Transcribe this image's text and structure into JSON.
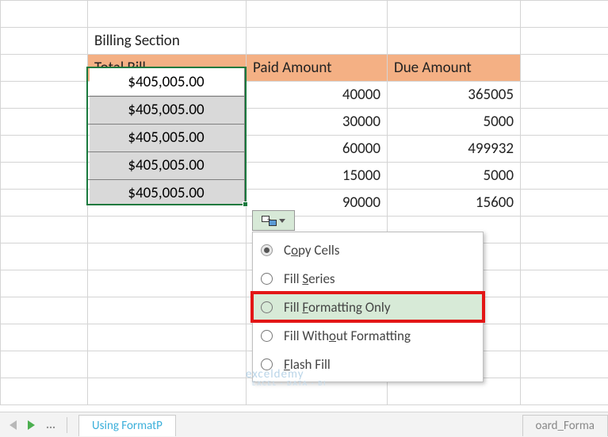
{
  "title_row": {
    "label": "Billing Section"
  },
  "headers": {
    "total": "Total Bill",
    "paid": "Paid Amount",
    "due": "Due Amount"
  },
  "rows": [
    {
      "total": "$405,005.00",
      "paid": "40000",
      "due": "365005"
    },
    {
      "total": "$405,005.00",
      "paid": "30000",
      "due": "5000"
    },
    {
      "total": "$405,005.00",
      "paid": "60000",
      "due": "499932"
    },
    {
      "total": "$405,005.00",
      "paid": "15000",
      "due": "5000"
    },
    {
      "total": "$405,005.00",
      "paid": "90000",
      "due": "15600"
    }
  ],
  "autofill_menu": {
    "copy_cells_pre": "C",
    "copy_cells_u": "o",
    "copy_cells_post": "py Cells",
    "fill_series_pre": "Fill ",
    "fill_series_u": "S",
    "fill_series_post": "eries",
    "fill_fmt_pre": "Fill ",
    "fill_fmt_u": "F",
    "fill_fmt_post": "ormatting Only",
    "fill_nofmt_pre": "Fill With",
    "fill_nofmt_u": "o",
    "fill_nofmt_post": "ut Formatting",
    "flash_pre": "",
    "flash_u": "F",
    "flash_post": "lash Fill"
  },
  "sheet_tabs": {
    "active": "Using FormatP",
    "inactive_right": "oard_Forma"
  },
  "watermark": {
    "line1": "exceldemy",
    "line2": "EXCEL · DATA · BI"
  }
}
